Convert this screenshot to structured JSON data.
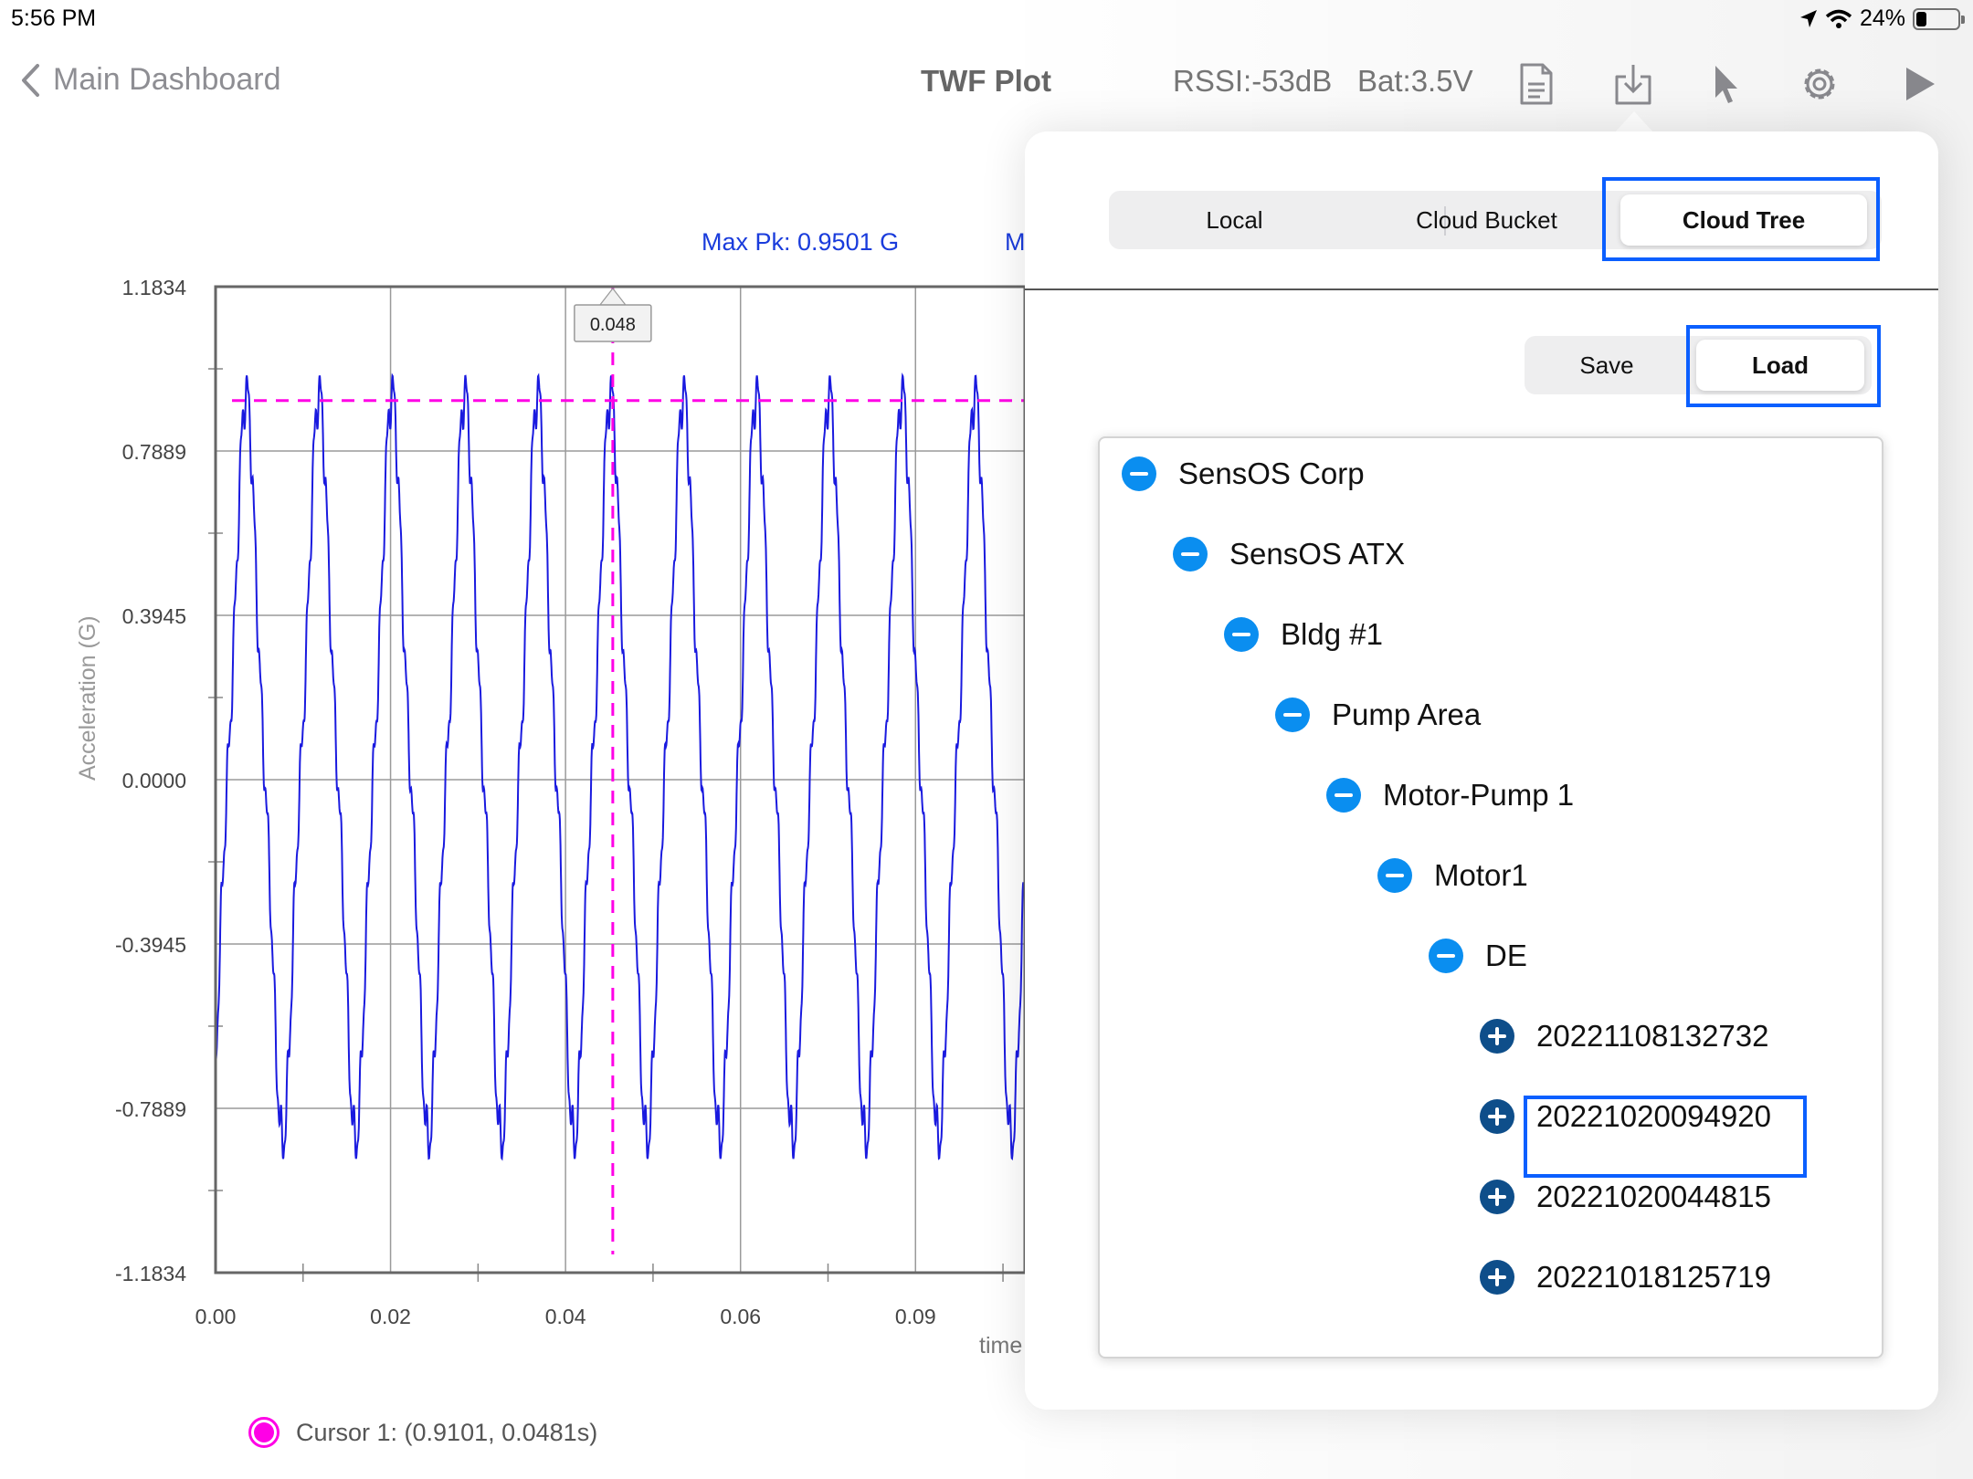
{
  "status_bar": {
    "time": "5:56 PM",
    "battery": "24%",
    "battery_level": 0.24,
    "icons": [
      "location-icon",
      "wifi-icon",
      "battery-icon"
    ]
  },
  "nav": {
    "back_label": "Main Dashboard",
    "title": "TWF Plot",
    "rssi": "RSSI:-53dB",
    "battery": "Bat:3.5V",
    "icons": [
      "report-icon",
      "download-icon",
      "cursor-pointer-icon",
      "gear-icon",
      "play-icon"
    ]
  },
  "chart_data": {
    "type": "line",
    "title": "Max Pk: 0.9501 G",
    "title_2": "M",
    "xlabel": "time",
    "ylabel": "Acceleration (G)",
    "ylim": [
      -1.1834,
      1.1834
    ],
    "xlim": [
      0.0,
      0.0925
    ],
    "y_ticks": [
      "1.1834",
      "0.7889",
      "0.3945",
      "0.0000",
      "-0.3945",
      "-0.7889",
      "-1.1834"
    ],
    "x_ticks": [
      "0.00",
      "0.02",
      "0.04",
      "0.06",
      "0.09"
    ],
    "series": [
      {
        "color": "#1a1adf",
        "waveform": {
          "period_s": 0.00833,
          "first_peak_s": 0.0035,
          "peak_g": 0.93,
          "trough_g": -0.87
        }
      }
    ],
    "max_peak_line": {
      "value": 0.9101,
      "color": "#ff00e6"
    },
    "cursor": {
      "x": 0.0454,
      "label": "0.048",
      "color": "#ff00e6"
    },
    "legend": {
      "label": "Cursor 1: (0.9101, 0.0481s)",
      "position": "bottom-left"
    },
    "grid": true
  },
  "popover": {
    "source_tabs": [
      "Local",
      "Cloud Bucket",
      "Cloud Tree"
    ],
    "selected_source": "Cloud Tree",
    "actions": [
      "Save",
      "Load"
    ],
    "selected_action": "Load",
    "tree": [
      {
        "label": "SensOS Corp",
        "icon": "collapse-icon"
      },
      {
        "label": "SensOS ATX",
        "icon": "collapse-icon"
      },
      {
        "label": "Bldg #1",
        "icon": "collapse-icon"
      },
      {
        "label": "Pump Area",
        "icon": "collapse-icon"
      },
      {
        "label": "Motor-Pump 1",
        "icon": "collapse-icon"
      },
      {
        "label": "Motor1",
        "icon": "collapse-icon"
      },
      {
        "label": "DE",
        "icon": "collapse-icon"
      },
      {
        "label": "20221108132732",
        "icon": "expand-icon"
      },
      {
        "label": "20221020094920",
        "icon": "expand-icon",
        "highlighted": true
      },
      {
        "label": "20221020044815",
        "icon": "expand-icon"
      },
      {
        "label": "20221018125719",
        "icon": "expand-icon"
      }
    ]
  }
}
